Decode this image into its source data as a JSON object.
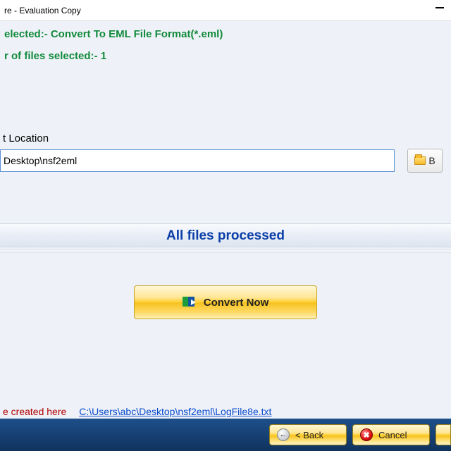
{
  "window": {
    "title": "re - Evaluation Copy"
  },
  "info": {
    "format_line": "elected:- Convert To EML File Format(*.eml)",
    "count_line": "r of files selected:- 1"
  },
  "output": {
    "label": "t Location",
    "path": "Desktop\\nsf2eml",
    "browse_label": "B"
  },
  "status": {
    "text": "All files processed"
  },
  "convert": {
    "label": "Convert Now"
  },
  "log": {
    "label": "e created here",
    "link": "C:\\Users\\abc\\Desktop\\nsf2eml\\LogFile8e.txt"
  },
  "nav": {
    "back": "< Back",
    "cancel": "Cancel"
  }
}
